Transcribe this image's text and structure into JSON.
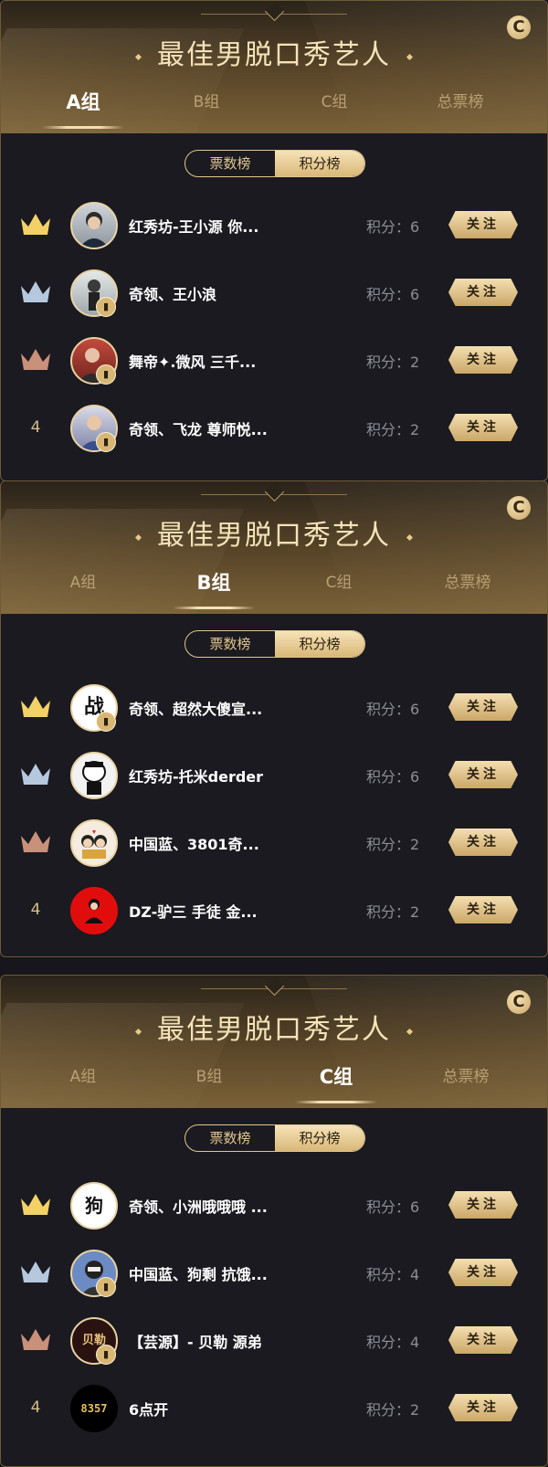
{
  "colors": {
    "gold_accent": "#e2c68e",
    "crown_gold": "#f2d266",
    "crown_silver": "#b6c8de",
    "crown_bronze": "#c9907a",
    "background": "#16161c"
  },
  "panels": [
    {
      "title": "最佳男脱口秀艺人",
      "badge": "C",
      "tabs": [
        "A组",
        "B组",
        "C组",
        "总票榜"
      ],
      "active_tab": "A组",
      "segments": [
        "票数榜",
        "积分榜"
      ],
      "active_segment": "积分榜",
      "rows": [
        {
          "rank": "1",
          "rank_icon": "crown-gold-icon",
          "name": "红秀坊-王小源 你...",
          "score": "积分：6",
          "follow": "关注"
        },
        {
          "rank": "2",
          "rank_icon": "crown-silver-icon",
          "name": "奇领、王小浪",
          "score": "积分：6",
          "follow": "关注"
        },
        {
          "rank": "3",
          "rank_icon": "crown-bronze-icon",
          "name": "舞帝✦.微风 三千...",
          "score": "积分：2",
          "follow": "关注"
        },
        {
          "rank": "4",
          "rank_icon": "",
          "name": "奇领、飞龙 尊师悦...",
          "score": "积分：2",
          "follow": "关注"
        }
      ]
    },
    {
      "title": "最佳男脱口秀艺人",
      "badge": "C",
      "tabs": [
        "A组",
        "B组",
        "C组",
        "总票榜"
      ],
      "active_tab": "B组",
      "segments": [
        "票数榜",
        "积分榜"
      ],
      "active_segment": "积分榜",
      "rows": [
        {
          "rank": "1",
          "rank_icon": "crown-gold-icon",
          "name": "奇领、超然大傻宣...",
          "score": "积分：6",
          "follow": "关注"
        },
        {
          "rank": "2",
          "rank_icon": "crown-silver-icon",
          "name": "红秀坊-托米derder",
          "score": "积分：6",
          "follow": "关注"
        },
        {
          "rank": "3",
          "rank_icon": "crown-bronze-icon",
          "name": "中国蓝、3801奇...",
          "score": "积分：2",
          "follow": "关注"
        },
        {
          "rank": "4",
          "rank_icon": "",
          "name": "DZ-驴三 手徒 金...",
          "score": "积分：2",
          "follow": "关注"
        }
      ]
    },
    {
      "title": "最佳男脱口秀艺人",
      "badge": "C",
      "tabs": [
        "A组",
        "B组",
        "C组",
        "总票榜"
      ],
      "active_tab": "C组",
      "segments": [
        "票数榜",
        "积分榜"
      ],
      "active_segment": "积分榜",
      "rows": [
        {
          "rank": "1",
          "rank_icon": "crown-gold-icon",
          "name": "奇领、小洲哦哦哦 ...",
          "score": "积分：6",
          "follow": "关注"
        },
        {
          "rank": "2",
          "rank_icon": "crown-silver-icon",
          "name": "中国蓝、狗剩 抗饿...",
          "score": "积分：4",
          "follow": "关注"
        },
        {
          "rank": "3",
          "rank_icon": "crown-bronze-icon",
          "name": "【芸源】- 贝勒 源弟",
          "score": "积分：4",
          "follow": "关注"
        },
        {
          "rank": "4",
          "rank_icon": "",
          "name": "6点开",
          "score": "积分：2",
          "follow": "关注"
        }
      ]
    }
  ],
  "avatars": [
    [
      "",
      "",
      "",
      ""
    ],
    [
      "战",
      "",
      "",
      ""
    ],
    [
      "狗",
      "",
      "贝勒",
      "8357"
    ]
  ]
}
